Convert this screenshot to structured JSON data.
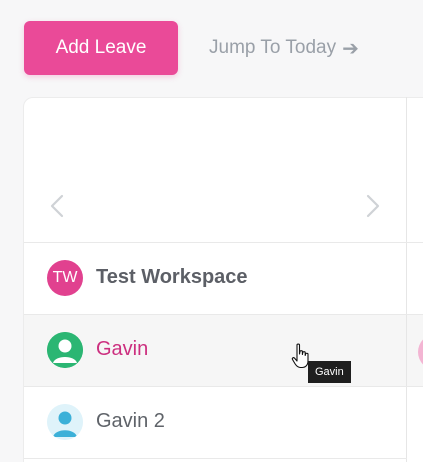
{
  "toolbar": {
    "add_leave_label": "Add Leave",
    "jump_to_today_label": "Jump To Today",
    "jump_arrow_glyph": "➔"
  },
  "calendar": {
    "prev_icon": "chevron-left-icon",
    "next_icon": "chevron-right-icon"
  },
  "rows": [
    {
      "avatar_text": "TW",
      "label": "Test Workspace",
      "avatar_color": "#e1418f"
    },
    {
      "avatar_icon": "user-avatar-icon",
      "label": "Gavin",
      "avatar_color": "#2bb673",
      "label_color": "#cc2f7f"
    },
    {
      "avatar_icon": "user-avatar-icon",
      "label": "Gavin 2",
      "avatar_color": "#3bb0d8"
    }
  ],
  "tooltip": {
    "text": "Gavin"
  },
  "colors": {
    "accent": "#ea4a98",
    "muted_text": "#9aa0a8"
  }
}
